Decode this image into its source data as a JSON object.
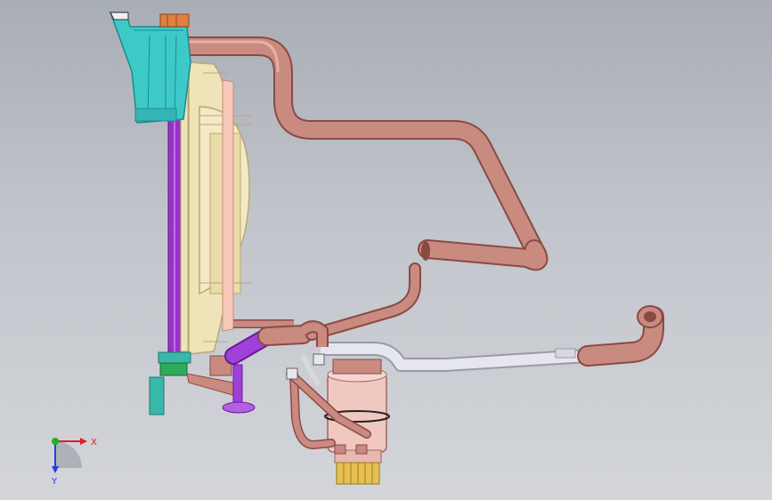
{
  "viewport": {
    "background_top": "#a9adb5",
    "background_bottom": "#d3d5da"
  },
  "triad": {
    "x_label": "X",
    "y_label": "Y",
    "x_color": "#e02020",
    "y_color": "#20b020",
    "z_color": "#2040e0"
  },
  "colors": {
    "hose": "#c98a80",
    "hose_dark": "#8a4a44",
    "tank": "#3ec9c9",
    "tank_dark": "#1f8a8a",
    "fan": "#efe4b8",
    "fan_dark": "#b8a878",
    "radiator": "#9a32c8",
    "pump": "#f0c8c0",
    "pipe_silver": "#e6e6ee",
    "bracket_green": "#2faa5a",
    "bracket_teal": "#38b8a8",
    "gold": "#e8c050",
    "orange_cap": "#e08040"
  }
}
